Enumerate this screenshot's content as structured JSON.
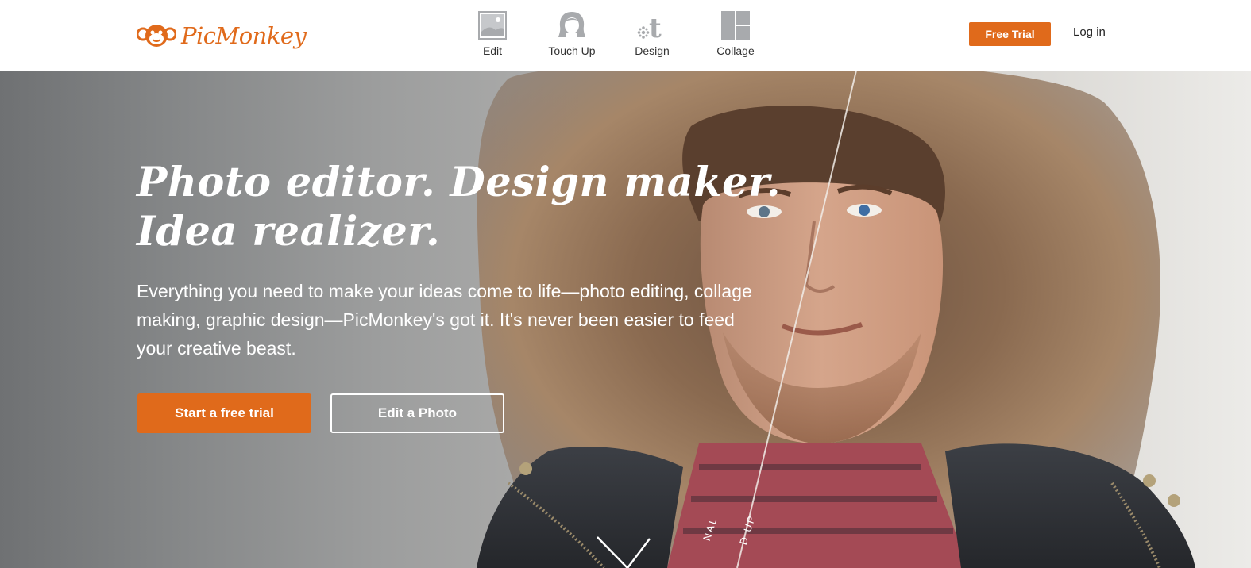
{
  "brand": {
    "name": "PicMonkey",
    "accent": "#e06a1b"
  },
  "nav": {
    "items": [
      {
        "label": "Edit",
        "icon": "photo-icon"
      },
      {
        "label": "Touch Up",
        "icon": "face-icon"
      },
      {
        "label": "Design",
        "icon": "design-icon"
      },
      {
        "label": "Collage",
        "icon": "collage-icon"
      }
    ],
    "free_trial": "Free Trial",
    "login": "Log in"
  },
  "hero": {
    "headline_line1": "Photo editor. Design maker.",
    "headline_line2": "Idea realizer.",
    "subtext": "Everything you need to make your ideas come to life—photo editing, collage making, graphic design—PicMonkey's got it. It's never been easier to feed your creative beast.",
    "primary_cta": "Start a free trial",
    "secondary_cta": "Edit a Photo",
    "split_label_left": "NAL",
    "split_label_right": "D UP"
  }
}
